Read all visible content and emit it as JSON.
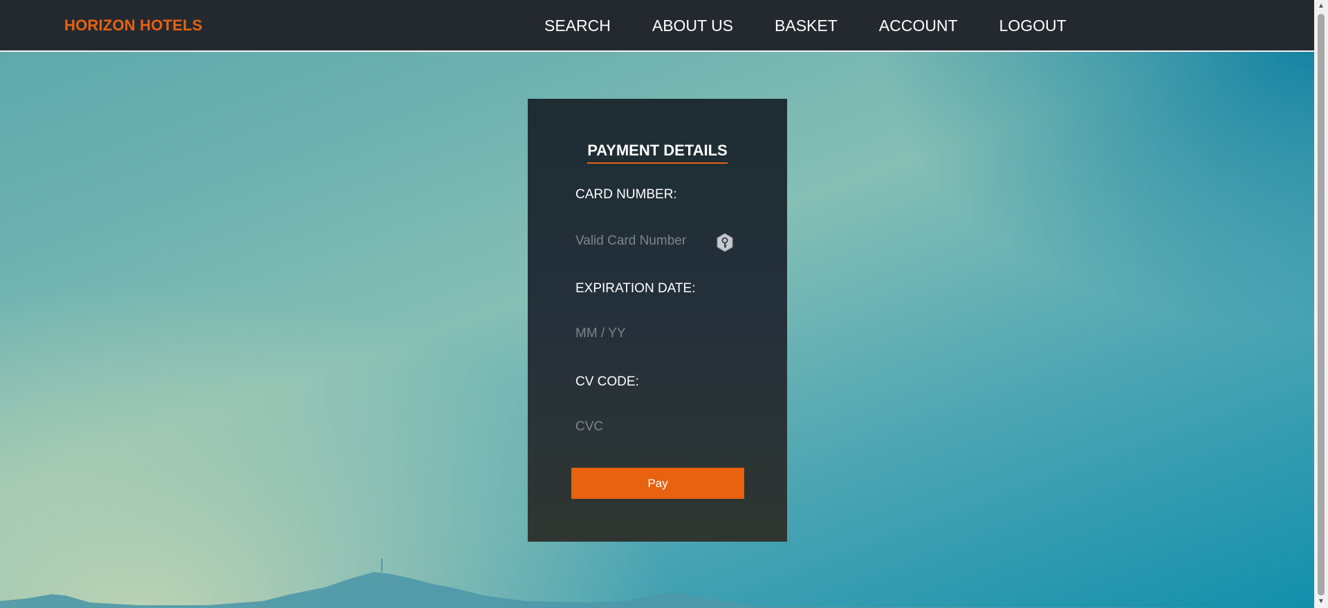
{
  "brand": {
    "name": "HORIZON HOTELS",
    "color": "#e8620f"
  },
  "nav": {
    "items": [
      {
        "label": "SEARCH"
      },
      {
        "label": "ABOUT US"
      },
      {
        "label": "BASKET"
      },
      {
        "label": "ACCOUNT"
      },
      {
        "label": "LOGOUT"
      }
    ]
  },
  "payment": {
    "title": "PAYMENT DETAILS",
    "card_number": {
      "label": "CARD NUMBER:",
      "placeholder": "Valid Card Number",
      "value": ""
    },
    "expiration": {
      "label": "EXPIRATION DATE:",
      "placeholder": "MM / YY",
      "value": ""
    },
    "cvc": {
      "label": "CV CODE:",
      "placeholder": "CVC",
      "value": ""
    },
    "pay_label": "Pay"
  },
  "theme": {
    "accent": "#e8620f",
    "navbar_bg": "#24292f",
    "card_bg": "#25303a"
  },
  "icons": {
    "autofill": "key-icon"
  }
}
